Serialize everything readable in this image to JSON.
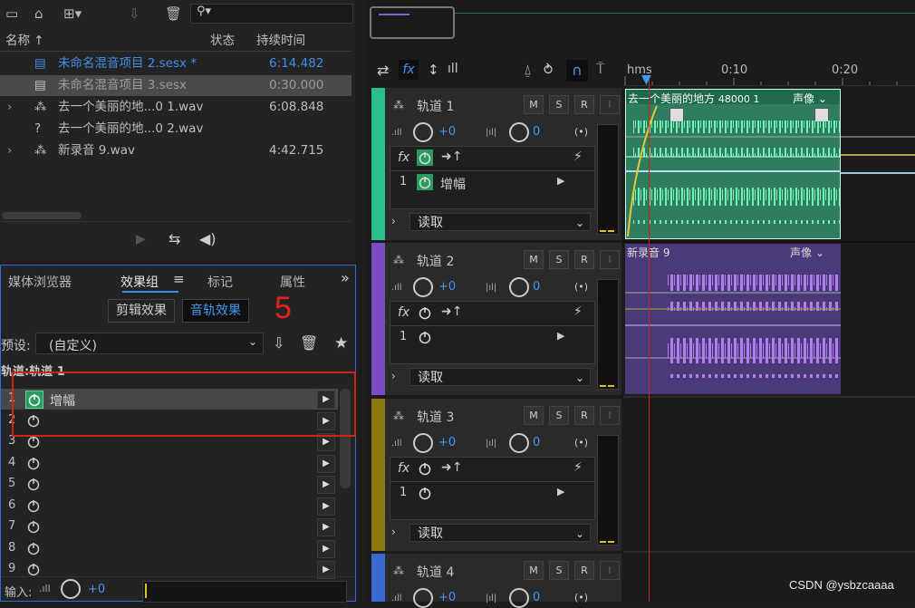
{
  "files_panel": {
    "columns": {
      "name": "名称",
      "status": "状态",
      "duration": "持续时间"
    },
    "files": [
      {
        "name": "未命名混音项目 2.sesx *",
        "duration": "6:14.482"
      },
      {
        "name": "未命名混音项目 3.sesx",
        "duration": "0:30.000"
      },
      {
        "name": "去一个美丽的地...0 1.wav",
        "duration": "6:08.848"
      },
      {
        "name": "去一个美丽的地...0 2.wav",
        "duration": ""
      },
      {
        "name": "新录音 9.wav",
        "duration": "4:42.715"
      }
    ]
  },
  "effects_panel": {
    "tabs": [
      "媒体浏览器",
      "效果组",
      "标记",
      "属性"
    ],
    "more": "»",
    "sub_tabs": [
      "剪辑效果",
      "音轨效果"
    ],
    "annotation": "5",
    "preset_label": "预设:",
    "preset_value": "(自定义)",
    "track_label": "轨道:轨道 1",
    "slots": [
      {
        "num": "1",
        "name": "增幅"
      },
      {
        "num": "2",
        "name": ""
      },
      {
        "num": "3",
        "name": ""
      },
      {
        "num": "4",
        "name": ""
      },
      {
        "num": "5",
        "name": ""
      },
      {
        "num": "6",
        "name": ""
      },
      {
        "num": "7",
        "name": ""
      },
      {
        "num": "8",
        "name": ""
      },
      {
        "num": "9",
        "name": ""
      }
    ],
    "input_label": "输入:",
    "input_value": "+0"
  },
  "timeline": {
    "ruler": [
      "hms",
      "0:10",
      "0:20"
    ],
    "tracks": [
      {
        "name": "轨道 1",
        "vol": "+0",
        "pan": "0",
        "fx_name": "增幅",
        "fx_num": "1",
        "mode": "读取",
        "color": "#2bbf8a"
      },
      {
        "name": "轨道 2",
        "vol": "+0",
        "pan": "0",
        "fx_name": "",
        "fx_num": "1",
        "mode": "读取",
        "color": "#7b4bc0"
      },
      {
        "name": "轨道 3",
        "vol": "+0",
        "pan": "0",
        "fx_name": "",
        "fx_num": "1",
        "mode": "读取",
        "color": "#8a7a10"
      },
      {
        "name": "轨道 4",
        "vol": "+0",
        "pan": "0",
        "fx_name": "",
        "fx_num": "",
        "mode": "",
        "color": "#3a6ad0"
      }
    ],
    "msr": [
      "M",
      "S",
      "R",
      "I"
    ],
    "clips": [
      {
        "name": "去一个美丽的地方",
        "info": "48000 1",
        "label": "声像"
      },
      {
        "name": "新录音 9",
        "info": "",
        "label": "声像"
      }
    ]
  },
  "watermark": "CSDN @ysbzcaaaa"
}
